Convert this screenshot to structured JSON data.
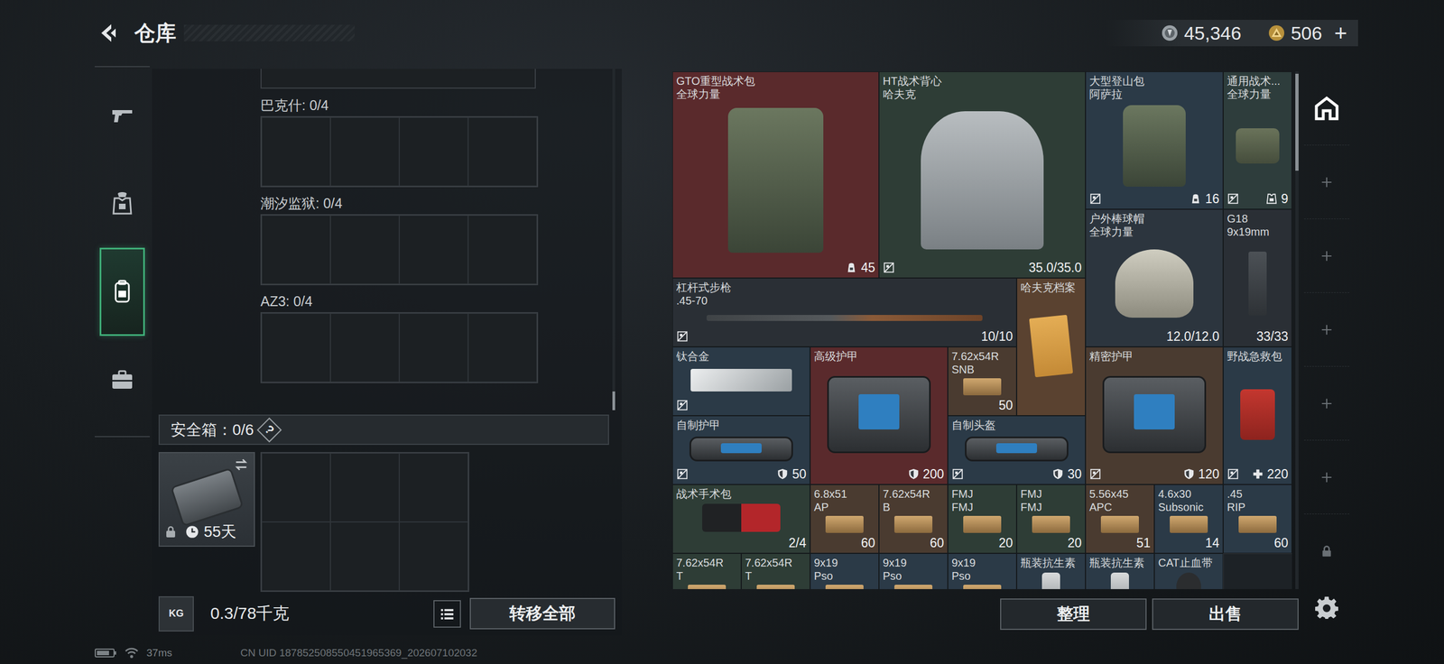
{
  "header": {
    "title": "仓库"
  },
  "currency": [
    {
      "kind": "silver",
      "amount": "45,346"
    },
    {
      "kind": "gold",
      "amount": "506",
      "add": "+"
    }
  ],
  "left_nav": [
    {
      "kind": "pistol",
      "selected": false
    },
    {
      "kind": "armor",
      "selected": false
    },
    {
      "kind": "backpack",
      "selected": true
    },
    {
      "kind": "case",
      "selected": false
    }
  ],
  "containers": [
    {
      "label": "巴克什: 0/4",
      "slots": 4
    },
    {
      "label": "潮汐监狱: 0/4",
      "slots": 4
    },
    {
      "label": "AZ3: 0/4",
      "slots": 4
    }
  ],
  "safe_box": {
    "label": "安全箱：0/6",
    "help": "?",
    "days": "55天",
    "locked": true,
    "slots": 6
  },
  "weight": {
    "unit": "KG",
    "value": "0.3/78千克"
  },
  "transfer_button": "转移全部",
  "inventory": {
    "items": [
      {
        "name": "GTO重型战术包",
        "brand": "全球力量",
        "w": 3,
        "h": 3,
        "color": "#5a2a2c",
        "kind": "pack",
        "unsecured": false,
        "badge": "capacity",
        "value": "45"
      },
      {
        "name": "HT战术背心",
        "brand": "哈夫克",
        "w": 3,
        "h": 3,
        "color": "#2e3d36",
        "kind": "vest",
        "unsecured": true,
        "badge": "none",
        "value": "35.0/35.0"
      },
      {
        "name": "大型登山包",
        "brand": "阿萨拉",
        "w": 2,
        "h": 2,
        "color": "#2b3a47",
        "kind": "pack",
        "unsecured": true,
        "badge": "capacity",
        "value": "16"
      },
      {
        "name": "通用战术...",
        "brand": "全球力量",
        "w": 1,
        "h": 2,
        "color": "#2e3d3c",
        "kind": "bag",
        "unsecured": true,
        "badge": "slots",
        "value": "9"
      },
      {
        "name": "户外棒球帽",
        "brand": "全球力量",
        "w": 2,
        "h": 2,
        "color": "#2c353e",
        "kind": "cap",
        "unsecured": false,
        "badge": "none",
        "value": "12.0/12.0"
      },
      {
        "name": "G18",
        "brand": "9x19mm",
        "w": 1,
        "h": 2,
        "color": "#2a2f35",
        "kind": "pistol",
        "unsecured": false,
        "badge": "none",
        "value": "33/33"
      },
      {
        "name": "杠杆式步枪",
        "brand": ".45-70",
        "w": 5,
        "h": 1,
        "color": "#2a2f35",
        "kind": "rifle",
        "unsecured": true,
        "badge": "none",
        "value": "10/10"
      },
      {
        "name": "哈夫克档案",
        "w": 1,
        "h": 2,
        "color": "#5a4230",
        "kind": "file",
        "unsecured": false,
        "badge": "none"
      },
      {
        "name": "钛合金",
        "w": 2,
        "h": 1,
        "color": "#2b3a47",
        "kind": "metal",
        "unsecured": true,
        "badge": "none"
      },
      {
        "name": "高级护甲",
        "w": 2,
        "h": 2,
        "color": "#5a2a2c",
        "kind": "armor",
        "unsecured": false,
        "badge": "durability",
        "value": "200"
      },
      {
        "name": "7.62x54R",
        "brand": "SNB",
        "w": 1,
        "h": 1,
        "color": "#4a3b30",
        "kind": "ammo",
        "unsecured": false,
        "badge": "none",
        "value": "50"
      },
      {
        "name": "精密护甲",
        "w": 2,
        "h": 2,
        "color": "#4a3b30",
        "kind": "armor",
        "unsecured": true,
        "badge": "durability",
        "value": "120"
      },
      {
        "name": "野战急救包",
        "w": 1,
        "h": 2,
        "color": "#2b3a47",
        "kind": "medkit",
        "unsecured": true,
        "badge": "heal",
        "value": "220"
      },
      {
        "name": "自制护甲",
        "w": 2,
        "h": 1,
        "color": "#2b3a47",
        "kind": "armor",
        "unsecured": true,
        "badge": "durability",
        "value": "50"
      },
      {
        "name": "自制头盔",
        "w": 2,
        "h": 1,
        "color": "#2b3a47",
        "kind": "armor",
        "unsecured": true,
        "badge": "durability",
        "value": "30"
      },
      {
        "name": "战术手术包",
        "w": 2,
        "h": 1,
        "color": "#2e3d36",
        "kind": "surgery",
        "unsecured": false,
        "badge": "none",
        "value": "2/4"
      },
      {
        "name": "6.8x51",
        "brand": "AP",
        "w": 1,
        "h": 1,
        "color": "#4a3b30",
        "kind": "ammo",
        "unsecured": false,
        "badge": "none",
        "value": "60"
      },
      {
        "name": "7.62x54R",
        "brand": "B",
        "w": 1,
        "h": 1,
        "color": "#4a3b30",
        "kind": "ammo",
        "unsecured": false,
        "badge": "none",
        "value": "60"
      },
      {
        "name": "FMJ",
        "brand": "FMJ",
        "w": 1,
        "h": 1,
        "color": "#2e3d36",
        "kind": "ammo",
        "unsecured": false,
        "badge": "none",
        "value": "20"
      },
      {
        "name": "FMJ",
        "brand": "FMJ",
        "w": 1,
        "h": 1,
        "color": "#2e3d36",
        "kind": "ammo",
        "unsecured": false,
        "badge": "none",
        "value": "20"
      },
      {
        "name": "5.56x45",
        "brand": "APC",
        "w": 1,
        "h": 1,
        "color": "#4a3b30",
        "kind": "ammo",
        "unsecured": false,
        "badge": "none",
        "value": "51"
      },
      {
        "name": "4.6x30",
        "brand": "Subsonic",
        "w": 1,
        "h": 1,
        "color": "#2b3a47",
        "kind": "ammo",
        "unsecured": false,
        "badge": "none",
        "value": "14"
      },
      {
        "name": ".45",
        "brand": "RIP",
        "w": 1,
        "h": 1,
        "color": "#2b3a47",
        "kind": "ammo",
        "unsecured": false,
        "badge": "none",
        "value": "60"
      },
      {
        "name": "7.62x54R",
        "brand": "T",
        "w": 1,
        "h": 1,
        "color": "#2e3d36",
        "kind": "ammo",
        "unsecured": false,
        "badge": "none"
      },
      {
        "name": "7.62x54R",
        "brand": "T",
        "w": 1,
        "h": 1,
        "color": "#2e3d36",
        "kind": "ammo",
        "unsecured": false,
        "badge": "none"
      },
      {
        "name": "9x19",
        "brand": "Pso",
        "w": 1,
        "h": 1,
        "color": "#2b3a47",
        "kind": "ammo",
        "unsecured": false,
        "badge": "none"
      },
      {
        "name": "9x19",
        "brand": "Pso",
        "w": 1,
        "h": 1,
        "color": "#2b3a47",
        "kind": "ammo",
        "unsecured": false,
        "badge": "none"
      },
      {
        "name": "9x19",
        "brand": "Pso",
        "w": 1,
        "h": 1,
        "color": "#2b3a47",
        "kind": "ammo",
        "unsecured": false,
        "badge": "none"
      },
      {
        "name": "瓶装抗生素",
        "w": 1,
        "h": 1,
        "color": "#2b3a47",
        "kind": "bottle",
        "unsecured": false,
        "badge": "none"
      },
      {
        "name": "瓶装抗生素",
        "w": 1,
        "h": 1,
        "color": "#2b3a47",
        "kind": "bottle",
        "unsecured": false,
        "badge": "none"
      },
      {
        "name": "CAT止血带",
        "w": 1,
        "h": 1,
        "color": "#2b3a47",
        "kind": "tourniquet",
        "unsecured": false,
        "badge": "none"
      }
    ]
  },
  "actions": [
    "整理",
    "出售"
  ],
  "right_nav": [
    {
      "kind": "home",
      "selected": true
    },
    {
      "kind": "add",
      "selected": false
    },
    {
      "kind": "add",
      "selected": false
    },
    {
      "kind": "add",
      "selected": false
    },
    {
      "kind": "add",
      "selected": false
    },
    {
      "kind": "add",
      "selected": false
    },
    {
      "kind": "lock",
      "selected": false
    },
    {
      "kind": "settings",
      "selected": false
    }
  ],
  "status_bar": {
    "ping": "37ms",
    "uid": "CN UID 187852508550451965369_202607102032"
  }
}
